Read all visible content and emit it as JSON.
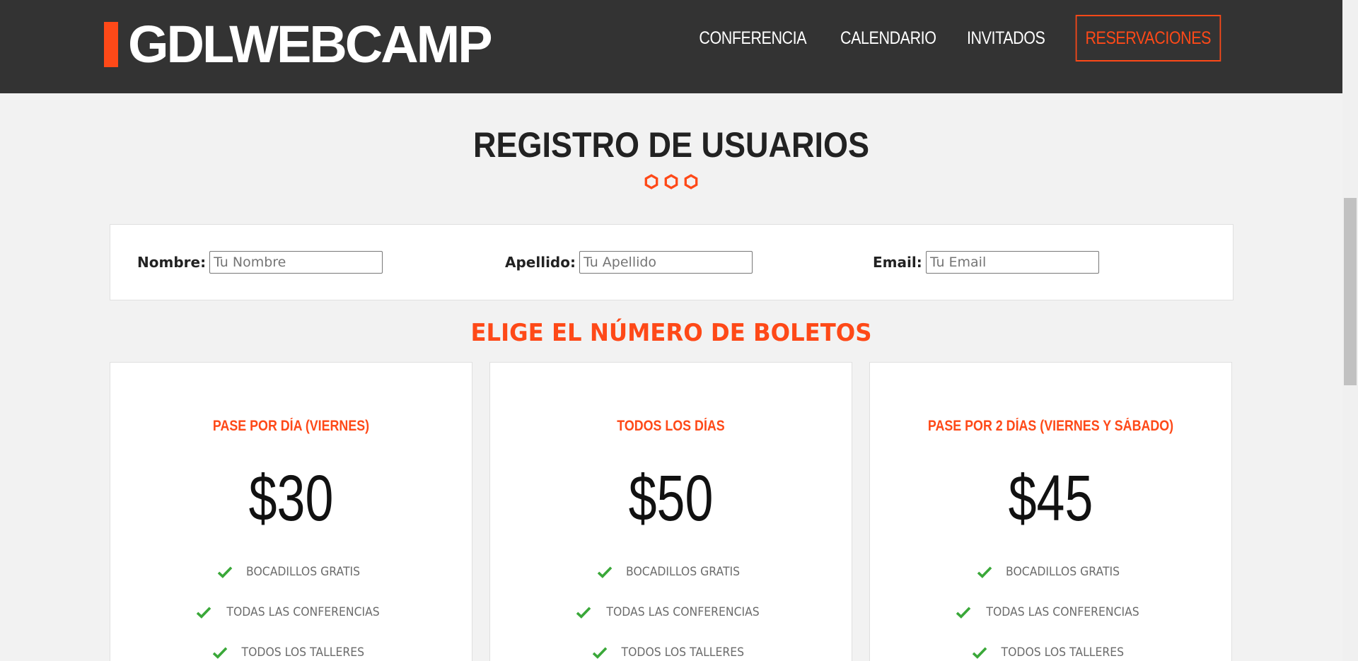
{
  "brand": {
    "name": "GDLWEBCAMP",
    "accent": "#fe4918"
  },
  "nav": {
    "items": [
      {
        "label": "CONFERENCIA"
      },
      {
        "label": "CALENDARIO"
      },
      {
        "label": "INVITADOS"
      },
      {
        "label": "RESERVACIONES"
      }
    ]
  },
  "page": {
    "title": "REGISTRO DE USUARIOS"
  },
  "form": {
    "nombre": {
      "label": "Nombre:",
      "placeholder": "Tu Nombre"
    },
    "apellido": {
      "label": "Apellido:",
      "placeholder": "Tu Apellido"
    },
    "email": {
      "label": "Email:",
      "placeholder": "Tu Email"
    }
  },
  "tickets": {
    "heading": "ELIGE EL NÚMERO DE BOLETOS",
    "plans": [
      {
        "title": "PASE POR DÍA (VIERNES)",
        "price": "$30",
        "features": [
          "BOCADILLOS GRATIS",
          "TODAS LAS CONFERENCIAS",
          "TODOS LOS TALLERES"
        ]
      },
      {
        "title": "TODOS LOS DÍAS",
        "price": "$50",
        "features": [
          "BOCADILLOS GRATIS",
          "TODAS LAS CONFERENCIAS",
          "TODOS LOS TALLERES"
        ]
      },
      {
        "title": "PASE POR 2 DÍAS (VIERNES Y SÁBADO)",
        "price": "$45",
        "features": [
          "BOCADILLOS GRATIS",
          "TODAS LAS CONFERENCIAS",
          "TODOS LOS TALLERES"
        ]
      }
    ]
  },
  "icons": {
    "feature": "check-icon",
    "divider": "hexagon-icon"
  },
  "colors": {
    "header_bg": "#333333",
    "check": "#3aa839",
    "page_bg": "#f2f2f2"
  }
}
